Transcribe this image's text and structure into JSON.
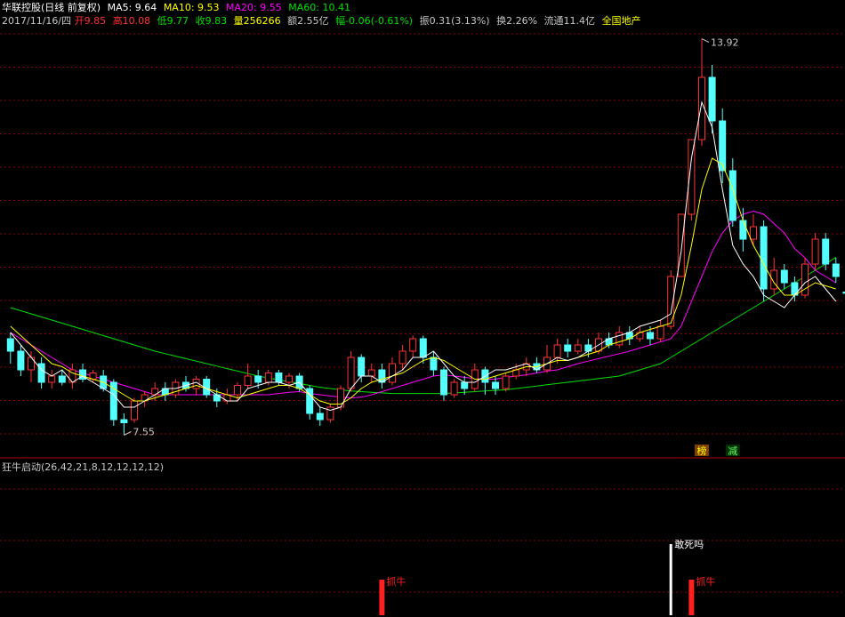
{
  "header": {
    "stock_title": "华联控股(日线 前复权)",
    "ma5": "MA5: 9.64",
    "ma10": "MA10: 9.53",
    "ma20": "MA20: 9.55",
    "ma60": "MA60: 10.41",
    "date": "2017/11/16/四",
    "open": "开9.85",
    "high": "高10.08",
    "low": "低9.77",
    "close": "收9.83",
    "volume": "量256266",
    "amount": "额2.55亿",
    "change": "幅-0.06(-0.61%)",
    "amplitude": "振0.31(3.13%)",
    "turnover": "换2.26%",
    "float_cap": "流通11.4亿",
    "sector": "全国地产"
  },
  "colors": {
    "up": "#ff3232",
    "down": "#54ffff",
    "ma5": "#ffffff",
    "ma10": "#ffff00",
    "ma20": "#ff00ff",
    "ma60": "#00e000",
    "grid": "#8b0000",
    "signal": "#ff2020"
  },
  "chart_data": [
    {
      "type": "candlestick",
      "title": "华联控股(日线 前复权)",
      "ylim": [
        7.4,
        14.0
      ],
      "max_label": "13.92",
      "min_label": "7.55",
      "series": [
        {
          "name": "MA5",
          "values": [
            9.2,
            9.0,
            8.8,
            8.6,
            8.5,
            8.6,
            8.4,
            8.5,
            8.4,
            8.3,
            8.2,
            8.0,
            8.0,
            8.1,
            8.2,
            8.3,
            8.3,
            8.35,
            8.4,
            8.3,
            8.2,
            8.1,
            8.1,
            8.3,
            8.35,
            8.4,
            8.4,
            8.35,
            8.4,
            8.2,
            8.0,
            7.95,
            8.0,
            8.3,
            8.5,
            8.5,
            8.4,
            8.5,
            8.6,
            8.8,
            8.8,
            8.9,
            8.7,
            8.5,
            8.4,
            8.4,
            8.5,
            8.6,
            8.6,
            8.65,
            8.7,
            8.6,
            8.7,
            8.8,
            8.75,
            8.8,
            8.9,
            9.0,
            9.1,
            9.15,
            9.2,
            9.3,
            9.35,
            9.4,
            9.5,
            10.5,
            12.0,
            12.9,
            12.5,
            11.5,
            10.6,
            10.3,
            10.1,
            9.8,
            9.7,
            9.6,
            9.8,
            10.0,
            10.1,
            9.9,
            9.7
          ]
        },
        {
          "name": "MA10",
          "values": [
            9.3,
            9.15,
            9.0,
            8.85,
            8.7,
            8.65,
            8.55,
            8.5,
            8.45,
            8.4,
            8.3,
            8.2,
            8.1,
            8.1,
            8.15,
            8.2,
            8.25,
            8.3,
            8.35,
            8.3,
            8.25,
            8.2,
            8.15,
            8.2,
            8.25,
            8.3,
            8.35,
            8.35,
            8.3,
            8.2,
            8.1,
            8.05,
            8.05,
            8.15,
            8.3,
            8.4,
            8.45,
            8.5,
            8.55,
            8.65,
            8.75,
            8.8,
            8.75,
            8.65,
            8.55,
            8.45,
            8.45,
            8.5,
            8.55,
            8.6,
            8.65,
            8.65,
            8.7,
            8.75,
            8.75,
            8.8,
            8.85,
            8.9,
            9.0,
            9.05,
            9.1,
            9.2,
            9.25,
            9.3,
            9.35,
            9.8,
            10.6,
            11.5,
            12.0,
            11.9,
            11.5,
            11.0,
            10.6,
            10.3,
            10.0,
            9.8,
            9.8,
            9.9,
            10.0,
            9.95,
            9.9
          ]
        },
        {
          "name": "MA20",
          "values": [
            9.2,
            9.1,
            9.0,
            8.9,
            8.8,
            8.7,
            8.6,
            8.55,
            8.5,
            8.45,
            8.4,
            8.35,
            8.3,
            8.25,
            8.2,
            8.2,
            8.2,
            8.2,
            8.2,
            8.2,
            8.2,
            8.2,
            8.2,
            8.2,
            8.2,
            8.2,
            8.22,
            8.24,
            8.25,
            8.22,
            8.2,
            8.18,
            8.16,
            8.15,
            8.16,
            8.2,
            8.25,
            8.3,
            8.35,
            8.4,
            8.45,
            8.5,
            8.52,
            8.5,
            8.48,
            8.46,
            8.45,
            8.45,
            8.48,
            8.5,
            8.52,
            8.55,
            8.58,
            8.6,
            8.65,
            8.7,
            8.74,
            8.78,
            8.82,
            8.86,
            8.9,
            8.95,
            9.0,
            9.05,
            9.1,
            9.3,
            9.7,
            10.1,
            10.5,
            10.8,
            11.0,
            11.1,
            11.15,
            11.1,
            10.95,
            10.8,
            10.55,
            10.4,
            10.2,
            10.1,
            10.0
          ]
        },
        {
          "name": "MA60",
          "values": [
            9.6,
            9.55,
            9.5,
            9.45,
            9.4,
            9.35,
            9.3,
            9.25,
            9.2,
            9.15,
            9.1,
            9.05,
            9.0,
            8.95,
            8.9,
            8.86,
            8.82,
            8.78,
            8.74,
            8.7,
            8.66,
            8.62,
            8.58,
            8.54,
            8.5,
            8.47,
            8.44,
            8.41,
            8.38,
            8.35,
            8.32,
            8.3,
            8.28,
            8.26,
            8.25,
            8.24,
            8.23,
            8.22,
            8.22,
            8.22,
            8.22,
            8.22,
            8.22,
            8.23,
            8.24,
            8.25,
            8.26,
            8.27,
            8.28,
            8.3,
            8.32,
            8.34,
            8.36,
            8.38,
            8.4,
            8.42,
            8.44,
            8.46,
            8.48,
            8.5,
            8.55,
            8.6,
            8.65,
            8.7,
            8.8,
            8.9,
            9.0,
            9.1,
            9.2,
            9.3,
            9.4,
            9.5,
            9.6,
            9.7,
            9.8,
            9.9,
            10.0,
            10.1,
            10.2,
            10.3,
            10.41
          ]
        }
      ],
      "candles": [
        {
          "o": 9.1,
          "c": 8.9,
          "h": 9.2,
          "l": 8.7
        },
        {
          "o": 8.9,
          "c": 8.6,
          "h": 9.0,
          "l": 8.5
        },
        {
          "o": 8.6,
          "c": 8.8,
          "h": 8.9,
          "l": 8.4
        },
        {
          "o": 8.7,
          "c": 8.4,
          "h": 8.8,
          "l": 8.3
        },
        {
          "o": 8.4,
          "c": 8.5,
          "h": 8.6,
          "l": 8.3
        },
        {
          "o": 8.5,
          "c": 8.4,
          "h": 8.6,
          "l": 8.35
        },
        {
          "o": 8.4,
          "c": 8.6,
          "h": 8.7,
          "l": 8.3
        },
        {
          "o": 8.6,
          "c": 8.45,
          "h": 8.7,
          "l": 8.4
        },
        {
          "o": 8.45,
          "c": 8.55,
          "h": 8.6,
          "l": 8.4
        },
        {
          "o": 8.5,
          "c": 8.3,
          "h": 8.6,
          "l": 8.25
        },
        {
          "o": 8.4,
          "c": 7.8,
          "h": 8.45,
          "l": 7.7
        },
        {
          "o": 7.8,
          "c": 7.75,
          "h": 7.9,
          "l": 7.55
        },
        {
          "o": 7.8,
          "c": 8.1,
          "h": 8.15,
          "l": 7.75
        },
        {
          "o": 8.1,
          "c": 8.2,
          "h": 8.25,
          "l": 8.0
        },
        {
          "o": 8.2,
          "c": 8.3,
          "h": 8.4,
          "l": 8.1
        },
        {
          "o": 8.3,
          "c": 8.2,
          "h": 8.4,
          "l": 8.1
        },
        {
          "o": 8.2,
          "c": 8.4,
          "h": 8.45,
          "l": 8.15
        },
        {
          "o": 8.4,
          "c": 8.3,
          "h": 8.5,
          "l": 8.25
        },
        {
          "o": 8.3,
          "c": 8.45,
          "h": 8.5,
          "l": 8.2
        },
        {
          "o": 8.45,
          "c": 8.2,
          "h": 8.5,
          "l": 8.15
        },
        {
          "o": 8.2,
          "c": 8.1,
          "h": 8.3,
          "l": 8.0
        },
        {
          "o": 8.1,
          "c": 8.2,
          "h": 8.3,
          "l": 8.05
        },
        {
          "o": 8.2,
          "c": 8.35,
          "h": 8.4,
          "l": 8.1
        },
        {
          "o": 8.35,
          "c": 8.5,
          "h": 8.7,
          "l": 8.3
        },
        {
          "o": 8.5,
          "c": 8.4,
          "h": 8.6,
          "l": 8.3
        },
        {
          "o": 8.4,
          "c": 8.55,
          "h": 8.6,
          "l": 8.35
        },
        {
          "o": 8.55,
          "c": 8.4,
          "h": 8.6,
          "l": 8.35
        },
        {
          "o": 8.4,
          "c": 8.5,
          "h": 8.55,
          "l": 8.3
        },
        {
          "o": 8.5,
          "c": 8.3,
          "h": 8.55,
          "l": 8.25
        },
        {
          "o": 8.3,
          "c": 7.9,
          "h": 8.35,
          "l": 7.8
        },
        {
          "o": 7.9,
          "c": 7.8,
          "h": 8.0,
          "l": 7.7
        },
        {
          "o": 7.8,
          "c": 8.0,
          "h": 8.05,
          "l": 7.75
        },
        {
          "o": 8.0,
          "c": 8.3,
          "h": 8.35,
          "l": 7.95
        },
        {
          "o": 8.3,
          "c": 8.8,
          "h": 8.9,
          "l": 8.25
        },
        {
          "o": 8.8,
          "c": 8.5,
          "h": 8.85,
          "l": 8.4
        },
        {
          "o": 8.5,
          "c": 8.6,
          "h": 8.7,
          "l": 8.4
        },
        {
          "o": 8.6,
          "c": 8.4,
          "h": 8.7,
          "l": 8.3
        },
        {
          "o": 8.4,
          "c": 8.7,
          "h": 8.8,
          "l": 8.35
        },
        {
          "o": 8.7,
          "c": 8.9,
          "h": 9.0,
          "l": 8.6
        },
        {
          "o": 8.9,
          "c": 9.1,
          "h": 9.15,
          "l": 8.8
        },
        {
          "o": 9.1,
          "c": 8.8,
          "h": 9.15,
          "l": 8.7
        },
        {
          "o": 8.8,
          "c": 8.6,
          "h": 8.9,
          "l": 8.5
        },
        {
          "o": 8.6,
          "c": 8.2,
          "h": 8.65,
          "l": 8.1
        },
        {
          "o": 8.2,
          "c": 8.4,
          "h": 8.45,
          "l": 8.15
        },
        {
          "o": 8.4,
          "c": 8.3,
          "h": 8.5,
          "l": 8.2
        },
        {
          "o": 8.3,
          "c": 8.6,
          "h": 8.7,
          "l": 8.25
        },
        {
          "o": 8.6,
          "c": 8.4,
          "h": 8.65,
          "l": 8.2
        },
        {
          "o": 8.4,
          "c": 8.3,
          "h": 8.5,
          "l": 8.2
        },
        {
          "o": 8.3,
          "c": 8.5,
          "h": 8.55,
          "l": 8.25
        },
        {
          "o": 8.5,
          "c": 8.6,
          "h": 8.7,
          "l": 8.45
        },
        {
          "o": 8.6,
          "c": 8.7,
          "h": 8.8,
          "l": 8.5
        },
        {
          "o": 8.7,
          "c": 8.6,
          "h": 8.8,
          "l": 8.55
        },
        {
          "o": 8.6,
          "c": 8.8,
          "h": 9.0,
          "l": 8.55
        },
        {
          "o": 8.8,
          "c": 9.0,
          "h": 9.1,
          "l": 8.7
        },
        {
          "o": 9.0,
          "c": 8.9,
          "h": 9.1,
          "l": 8.8
        },
        {
          "o": 8.9,
          "c": 9.0,
          "h": 9.1,
          "l": 8.85
        },
        {
          "o": 9.0,
          "c": 8.9,
          "h": 9.1,
          "l": 8.8
        },
        {
          "o": 8.9,
          "c": 9.1,
          "h": 9.2,
          "l": 8.85
        },
        {
          "o": 9.1,
          "c": 9.0,
          "h": 9.2,
          "l": 8.95
        },
        {
          "o": 9.0,
          "c": 9.2,
          "h": 9.3,
          "l": 8.95
        },
        {
          "o": 9.2,
          "c": 9.1,
          "h": 9.3,
          "l": 9.0
        },
        {
          "o": 9.1,
          "c": 9.2,
          "h": 9.3,
          "l": 9.05
        },
        {
          "o": 9.2,
          "c": 9.1,
          "h": 9.3,
          "l": 9.0
        },
        {
          "o": 9.1,
          "c": 9.3,
          "h": 9.4,
          "l": 9.05
        },
        {
          "o": 9.3,
          "c": 10.1,
          "h": 10.2,
          "l": 9.25
        },
        {
          "o": 10.1,
          "c": 11.1,
          "h": 11.1,
          "l": 10.1
        },
        {
          "o": 11.1,
          "c": 12.3,
          "h": 12.3,
          "l": 11.0
        },
        {
          "o": 12.3,
          "c": 13.3,
          "h": 13.92,
          "l": 12.2
        },
        {
          "o": 13.3,
          "c": 12.6,
          "h": 13.5,
          "l": 12.4
        },
        {
          "o": 12.6,
          "c": 11.8,
          "h": 12.8,
          "l": 11.6
        },
        {
          "o": 11.8,
          "c": 11.0,
          "h": 12.0,
          "l": 10.9
        },
        {
          "o": 11.0,
          "c": 10.7,
          "h": 11.2,
          "l": 10.5
        },
        {
          "o": 10.7,
          "c": 10.9,
          "h": 11.1,
          "l": 10.6
        },
        {
          "o": 10.9,
          "c": 9.9,
          "h": 11.0,
          "l": 9.7
        },
        {
          "o": 9.9,
          "c": 10.2,
          "h": 10.4,
          "l": 9.8
        },
        {
          "o": 10.2,
          "c": 10.0,
          "h": 10.3,
          "l": 9.9
        },
        {
          "o": 10.0,
          "c": 9.8,
          "h": 10.1,
          "l": 9.7
        },
        {
          "o": 9.8,
          "c": 10.3,
          "h": 10.4,
          "l": 9.75
        },
        {
          "o": 10.3,
          "c": 10.7,
          "h": 10.8,
          "l": 10.2
        },
        {
          "o": 10.7,
          "c": 10.3,
          "h": 10.8,
          "l": 10.2
        },
        {
          "o": 10.3,
          "c": 10.1,
          "h": 10.4,
          "l": 10.0
        },
        {
          "o": 9.85,
          "c": 9.83,
          "h": 10.08,
          "l": 9.77
        }
      ],
      "markers": [
        {
          "text": "榜",
          "index": 67,
          "color": "#ffff00",
          "bg": "#804000"
        },
        {
          "text": "减",
          "index": 70,
          "color": "#60ff60",
          "bg": "#003000"
        }
      ]
    },
    {
      "type": "bar",
      "title": "狂牛启动(26,42,21,8,12,12,12,12)",
      "signals": [
        {
          "index": 36,
          "label": "抓牛"
        },
        {
          "index": 66,
          "label": "抓牛"
        }
      ],
      "warnings": [
        {
          "index": 64,
          "label": "敢死吗"
        }
      ]
    }
  ]
}
